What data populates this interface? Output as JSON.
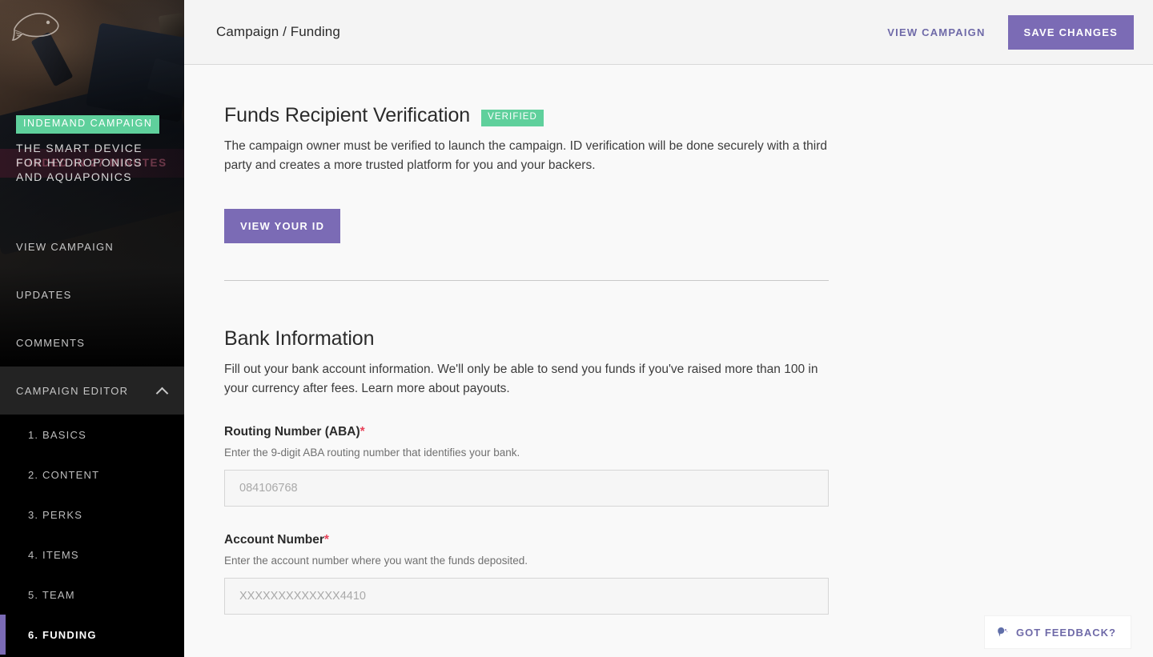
{
  "sidebar": {
    "logo_name": "fish-logo",
    "hero": {
      "badge": "INDEMAND CAMPAIGN",
      "title": "THE SMART DEVICE FOR HYDROPONICS AND AQUAPONICS",
      "overlay_text": "FUNDED IN 27 MINUTES"
    },
    "nav": [
      {
        "label": "VIEW CAMPAIGN",
        "name": "sidebar-item-view-campaign"
      },
      {
        "label": "UPDATES",
        "name": "sidebar-item-updates"
      },
      {
        "label": "COMMENTS",
        "name": "sidebar-item-comments"
      }
    ],
    "group": {
      "label": "CAMPAIGN EDITOR",
      "expanded": true,
      "icon": "chevron-up-icon"
    },
    "steps": [
      {
        "label": "1. BASICS",
        "name": "sidebar-step-basics",
        "active": false
      },
      {
        "label": "2. CONTENT",
        "name": "sidebar-step-content",
        "active": false
      },
      {
        "label": "3. PERKS",
        "name": "sidebar-step-perks",
        "active": false
      },
      {
        "label": "4. ITEMS",
        "name": "sidebar-step-items",
        "active": false
      },
      {
        "label": "5. TEAM",
        "name": "sidebar-step-team",
        "active": false
      },
      {
        "label": "6. FUNDING",
        "name": "sidebar-step-funding",
        "active": true
      }
    ]
  },
  "topbar": {
    "breadcrumb": "Campaign / Funding",
    "view_campaign_label": "VIEW CAMPAIGN",
    "save_changes_label": "SAVE CHANGES",
    "accent_color": "#f8d26a",
    "primary_color": "#7b6bb5"
  },
  "verification": {
    "title": "Funds Recipient Verification",
    "badge": "VERIFIED",
    "badge_color": "#5fd09c",
    "description": "The campaign owner must be verified to launch the campaign. ID verification will be done securely with a third party and creates a more trusted platform for you and your backers.",
    "button_label": "VIEW YOUR ID"
  },
  "bank": {
    "title": "Bank Information",
    "description": "Fill out your bank account information. We'll only be able to send you funds if you've raised more than 100 in your currency after fees. Learn more about payouts.",
    "fields": [
      {
        "label": "Routing Number (ABA)",
        "required_marker": "*",
        "help": "Enter the 9-digit ABA routing number that identifies your bank.",
        "value": "",
        "placeholder": "084106768",
        "name": "routing-number-input"
      },
      {
        "label": "Account Number",
        "required_marker": "*",
        "help": "Enter the account number where you want the funds deposited.",
        "value": "",
        "placeholder": "XXXXXXXXXXXXX4410",
        "name": "account-number-input"
      }
    ]
  },
  "feedback": {
    "label": "GOT FEEDBACK?",
    "icon": "megaphone-icon"
  }
}
